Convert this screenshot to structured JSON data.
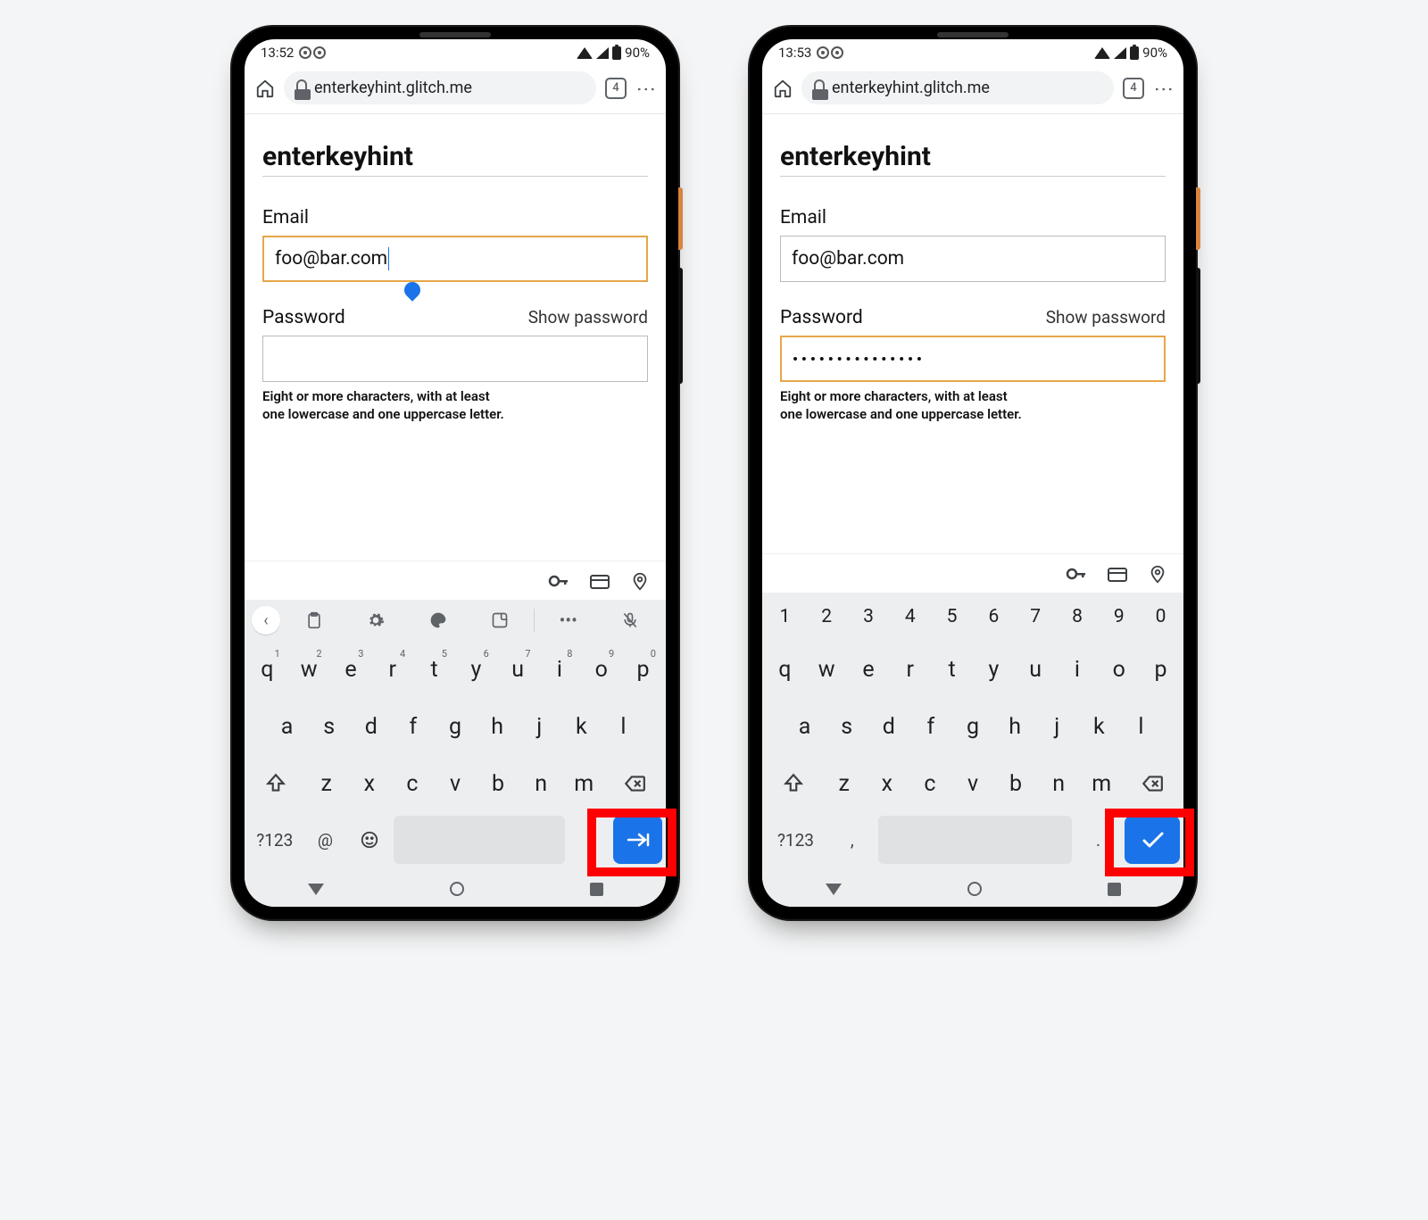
{
  "phones": [
    {
      "status": {
        "time": "13:52",
        "battery_text": "90%"
      },
      "omnibox": {
        "url": "enterkeyhint.glitch.me",
        "tab_count": "4"
      },
      "page": {
        "heading": "enterkeyhint",
        "email_label": "Email",
        "email_value": "foo@bar.com",
        "email_focused": true,
        "password_label": "Password",
        "show_password": "Show password",
        "password_value": "",
        "password_focused": false,
        "hint_line1": "Eight or more characters, with at least",
        "hint_line2": "one lowercase and one uppercase letter."
      },
      "keyboard": {
        "variant": "email",
        "toolbar": true,
        "num_row_visible": false,
        "row1": [
          {
            "k": "q",
            "sup": "1"
          },
          {
            "k": "w",
            "sup": "2"
          },
          {
            "k": "e",
            "sup": "3"
          },
          {
            "k": "r",
            "sup": "4"
          },
          {
            "k": "t",
            "sup": "5"
          },
          {
            "k": "y",
            "sup": "6"
          },
          {
            "k": "u",
            "sup": "7"
          },
          {
            "k": "i",
            "sup": "8"
          },
          {
            "k": "o",
            "sup": "9"
          },
          {
            "k": "p",
            "sup": "0"
          }
        ],
        "row2": [
          "a",
          "s",
          "d",
          "f",
          "g",
          "h",
          "j",
          "k",
          "l"
        ],
        "row3": [
          "z",
          "x",
          "c",
          "v",
          "b",
          "n",
          "m"
        ],
        "bottom": {
          "sym": "?123",
          "alt": "@",
          "emoji": "☺",
          "period": ".",
          "enter_icon": "next"
        }
      }
    },
    {
      "status": {
        "time": "13:53",
        "battery_text": "90%"
      },
      "omnibox": {
        "url": "enterkeyhint.glitch.me",
        "tab_count": "4"
      },
      "page": {
        "heading": "enterkeyhint",
        "email_label": "Email",
        "email_value": "foo@bar.com",
        "email_focused": false,
        "password_label": "Password",
        "show_password": "Show password",
        "password_value": "•••••••••••••••",
        "password_focused": true,
        "hint_line1": "Eight or more characters, with at least",
        "hint_line2": "one lowercase and one uppercase letter."
      },
      "keyboard": {
        "variant": "password",
        "toolbar": false,
        "num_row_visible": true,
        "num_row": [
          "1",
          "2",
          "3",
          "4",
          "5",
          "6",
          "7",
          "8",
          "9",
          "0"
        ],
        "row1": [
          {
            "k": "q"
          },
          {
            "k": "w"
          },
          {
            "k": "e"
          },
          {
            "k": "r"
          },
          {
            "k": "t"
          },
          {
            "k": "y"
          },
          {
            "k": "u"
          },
          {
            "k": "i"
          },
          {
            "k": "o"
          },
          {
            "k": "p"
          }
        ],
        "row2": [
          "a",
          "s",
          "d",
          "f",
          "g",
          "h",
          "j",
          "k",
          "l"
        ],
        "row3": [
          "z",
          "x",
          "c",
          "v",
          "b",
          "n",
          "m"
        ],
        "bottom": {
          "sym": "?123",
          "alt": ",",
          "emoji": "",
          "period": ".",
          "enter_icon": "done"
        }
      }
    }
  ]
}
